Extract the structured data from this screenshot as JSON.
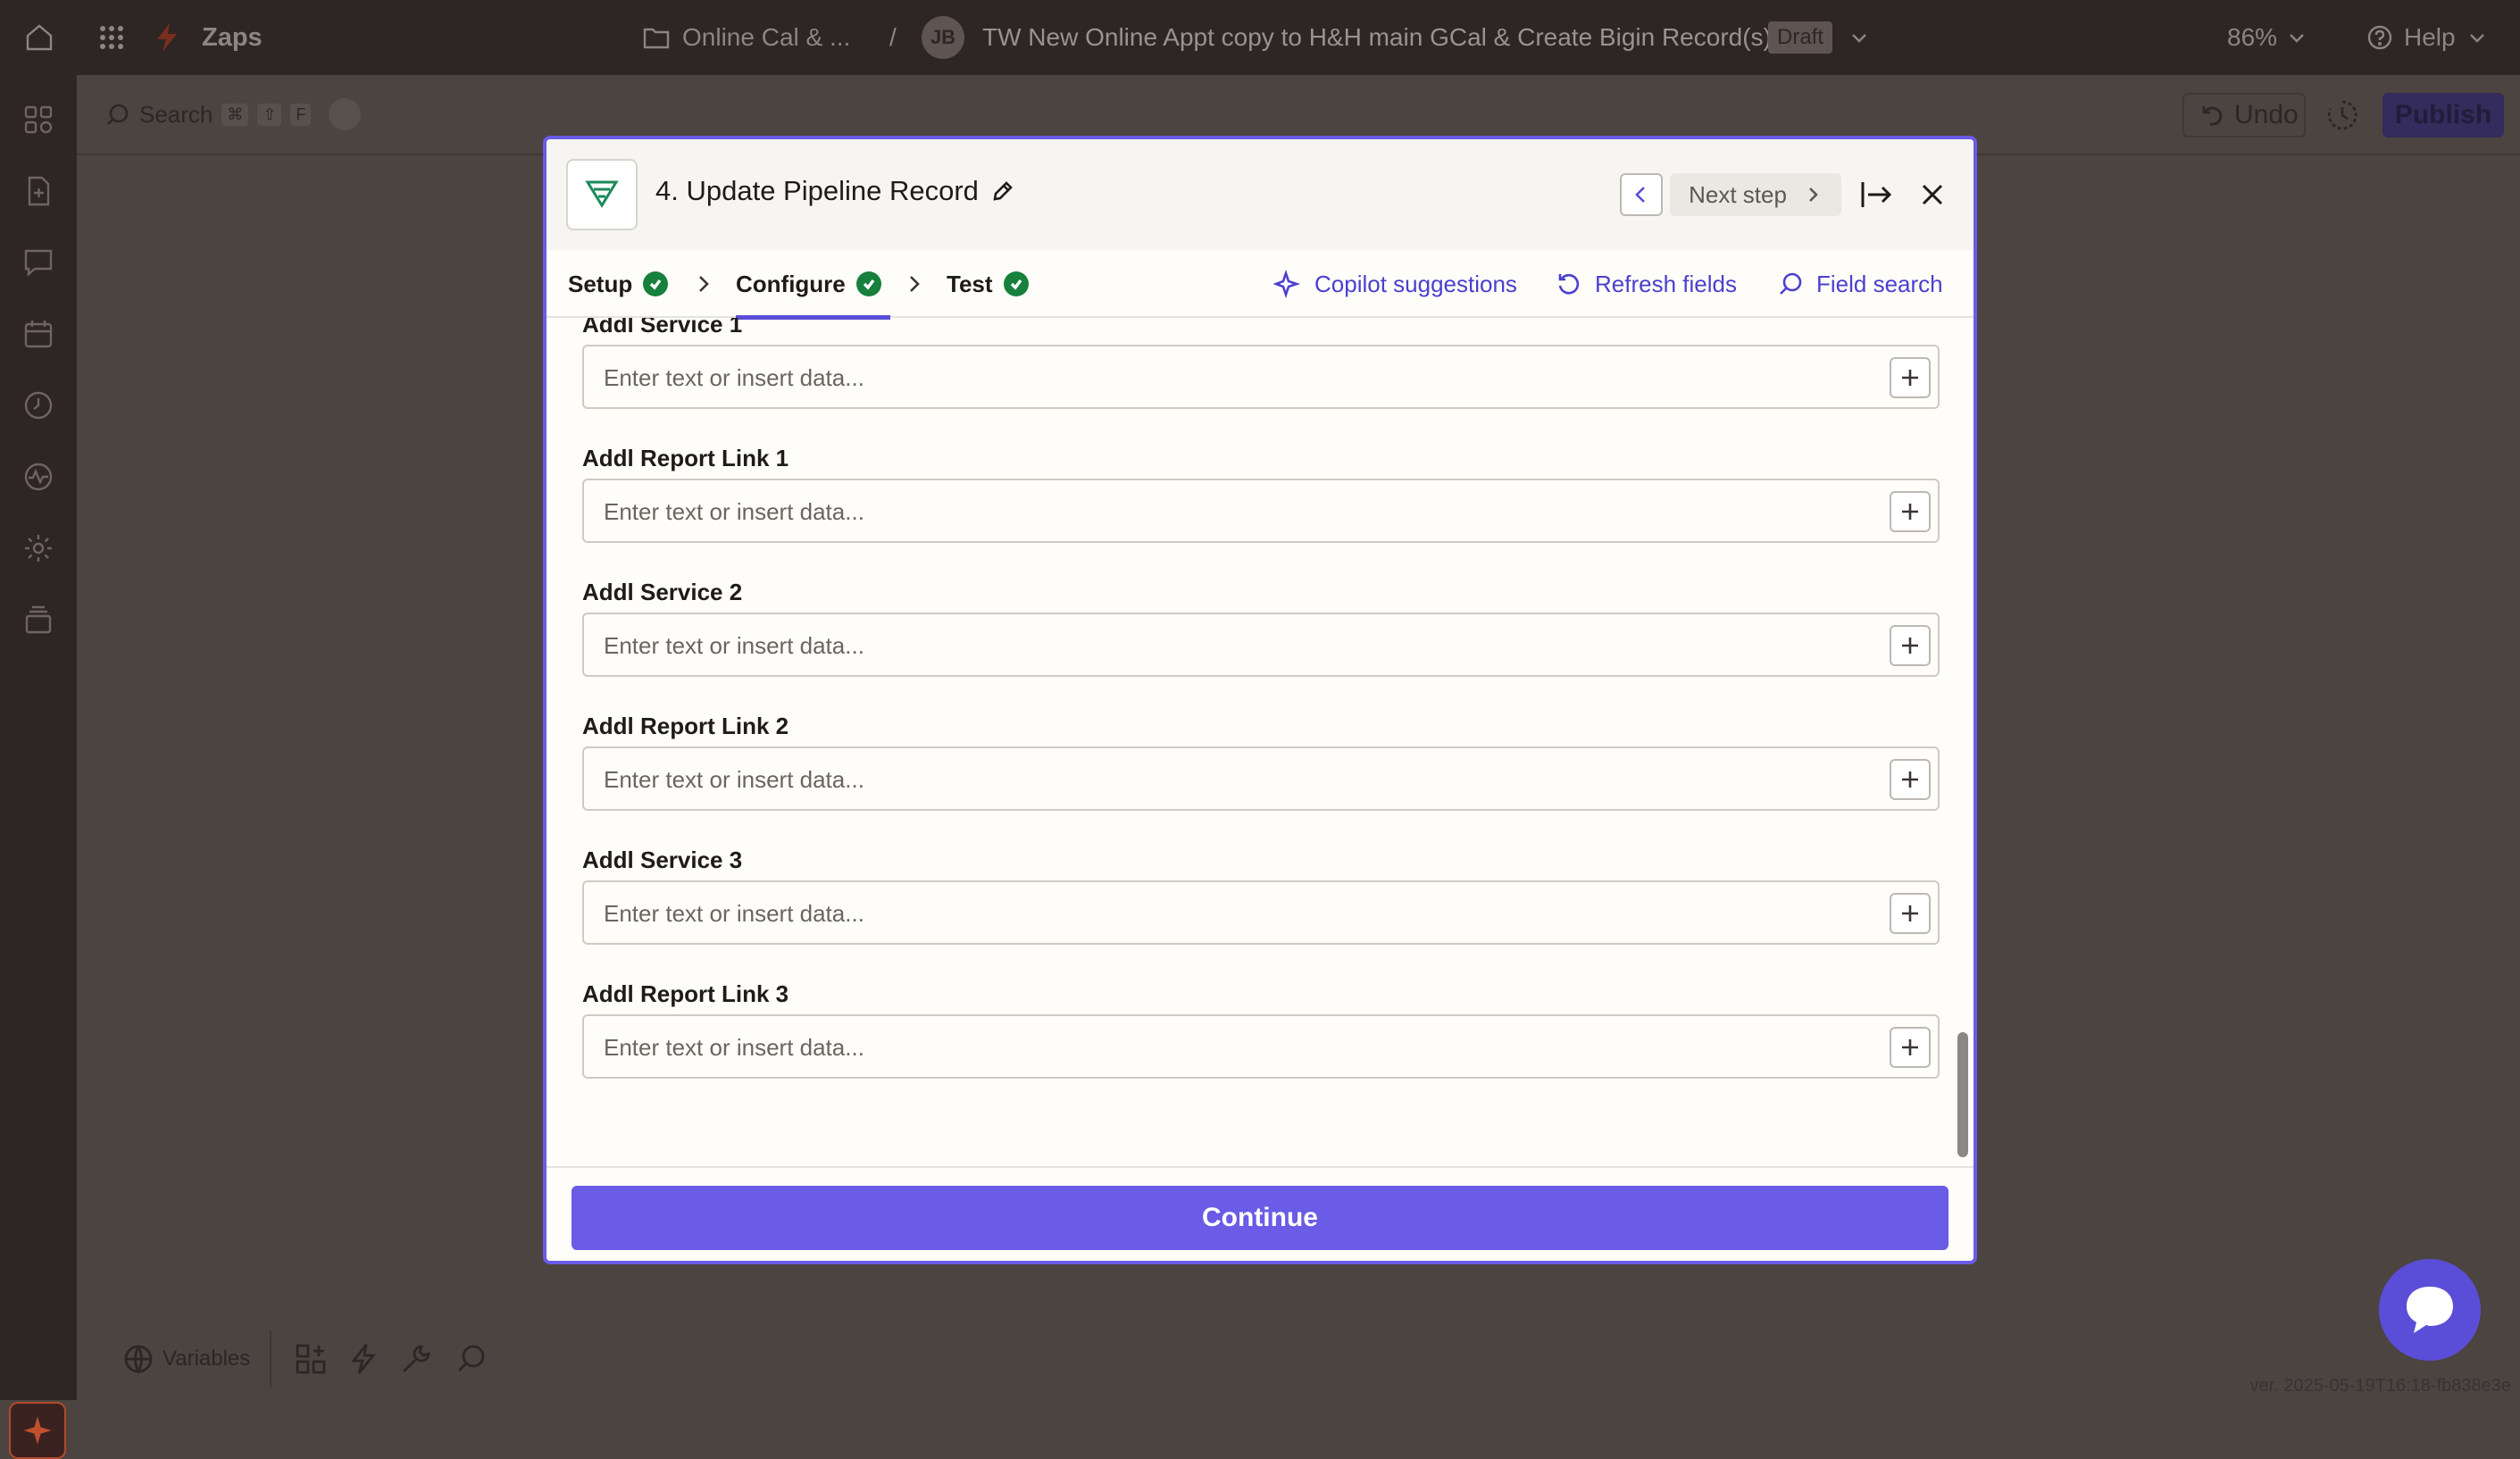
{
  "topbar": {
    "app_name": "Zaps",
    "folder": "Online Cal & ...",
    "separator": "/",
    "owner_initials": "JB",
    "zap_title": "TW New Online Appt copy to H&H main GCal & Create Bigin Record(s)",
    "status_badge": "Draft",
    "zoom": "86%",
    "help_label": "Help"
  },
  "canvas": {
    "search_label": "Search",
    "shortcut_keys": [
      "⌘",
      "⇧",
      "F"
    ],
    "undo_label": "Undo",
    "publish_label": "Publish",
    "variables_label": "Variables",
    "version_text": "ver. 2025-05-19T16:18-fb838e3e"
  },
  "modal": {
    "step_title": "4. Update Pipeline Record",
    "next_step_label": "Next step",
    "tabs": [
      {
        "label": "Setup"
      },
      {
        "label": "Configure"
      },
      {
        "label": "Test"
      }
    ],
    "tools": {
      "copilot": "Copilot suggestions",
      "refresh": "Refresh fields",
      "search": "Field search"
    },
    "fields": [
      {
        "label": "Addl Service 1",
        "placeholder": "Enter text or insert data..."
      },
      {
        "label": "Addl Report Link 1",
        "placeholder": "Enter text or insert data..."
      },
      {
        "label": "Addl Service 2",
        "placeholder": "Enter text or insert data..."
      },
      {
        "label": "Addl Report Link 2",
        "placeholder": "Enter text or insert data..."
      },
      {
        "label": "Addl Service 3",
        "placeholder": "Enter text or insert data..."
      },
      {
        "label": "Addl Report Link 3",
        "placeholder": "Enter text or insert data..."
      }
    ],
    "continue_label": "Continue"
  },
  "colors": {
    "accent": "#6a5ce6",
    "success": "#16803c",
    "chrome": "#2e2624"
  }
}
